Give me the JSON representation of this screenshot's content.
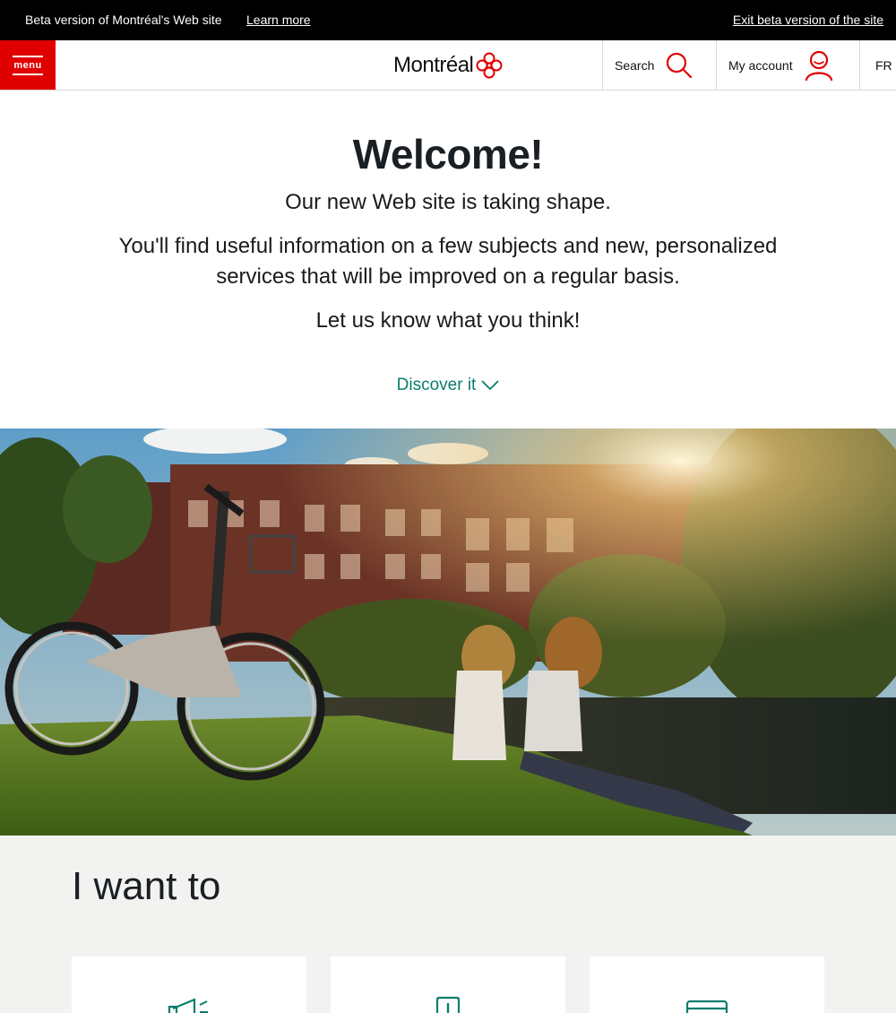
{
  "beta_bar": {
    "text": "Beta version of Montréal's Web site",
    "learn_more": "Learn more",
    "exit": "Exit beta version of the site"
  },
  "header": {
    "menu_label": "menu",
    "logo_text": "Montréal",
    "search_label": "Search",
    "account_label": "My account",
    "lang_label": "FR"
  },
  "welcome": {
    "title": "Welcome!",
    "line1": "Our new Web site is taking shape.",
    "line2": "You'll find useful information on a few subjects and new, personalized services that will be improved on a regular basis.",
    "line3": "Let us know what you think!",
    "discover": "Discover it"
  },
  "iwant": {
    "title": "I want to",
    "cards": [
      {
        "icon": "megaphone-icon"
      },
      {
        "icon": "document-alert-icon"
      },
      {
        "icon": "card-icon"
      }
    ]
  },
  "colors": {
    "brand_red": "#e00000",
    "accent_teal": "#097d6c",
    "section_gray": "#f2f2f0"
  }
}
